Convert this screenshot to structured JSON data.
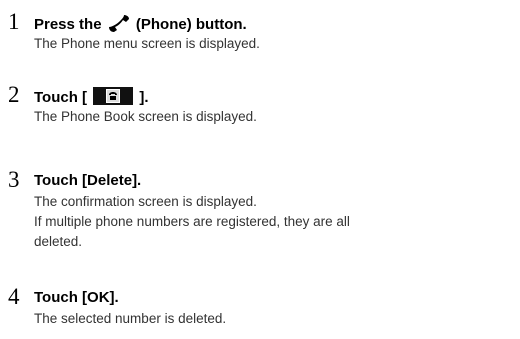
{
  "steps": [
    {
      "number": "1",
      "title_before": "Press the",
      "title_after": "(Phone) button.",
      "icon": "phone-handset-icon",
      "description_lines": [
        "The Phone menu screen is displayed."
      ]
    },
    {
      "number": "2",
      "title_before": "Touch [",
      "title_after": "].",
      "icon": "phone-book-button-icon",
      "description_lines": [
        "The Phone Book screen is displayed."
      ]
    },
    {
      "number": "3",
      "title": "Touch [Delete].",
      "description_lines": [
        "The confirmation screen is displayed.",
        "If multiple phone numbers are registered, they are all",
        "deleted."
      ]
    },
    {
      "number": "4",
      "title": "Touch [OK].",
      "description_lines": [
        "The selected number is deleted."
      ]
    }
  ]
}
